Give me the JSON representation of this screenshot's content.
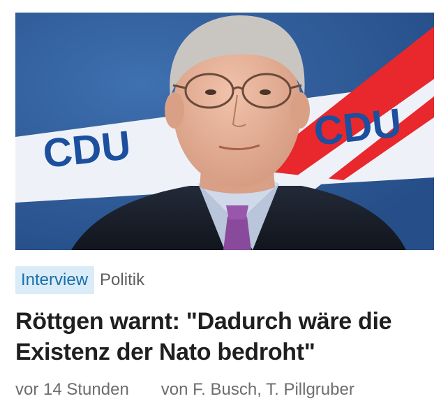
{
  "article": {
    "image": {
      "alt": "",
      "backdrop_text": "CDU",
      "colors": {
        "background_blue": "#2f5f9f",
        "band_white": "#eef2f8",
        "accent_red": "#e8282c",
        "logo_blue": "#1c4f9e",
        "suit": "#1a1f2b",
        "shirt": "#cfd9ea",
        "tie": "#8a4a9c",
        "skin": "#e9b39a",
        "hair": "#c9c6c2"
      }
    },
    "tag": "Interview",
    "category": "Politik",
    "headline_line1": "Röttgen warnt: \"Dadurch wäre die",
    "headline_line2": "Existenz der Nato bedroht\"",
    "time_ago": "vor 14 Stunden",
    "authors": "von F. Busch, T. Pillgruber"
  }
}
